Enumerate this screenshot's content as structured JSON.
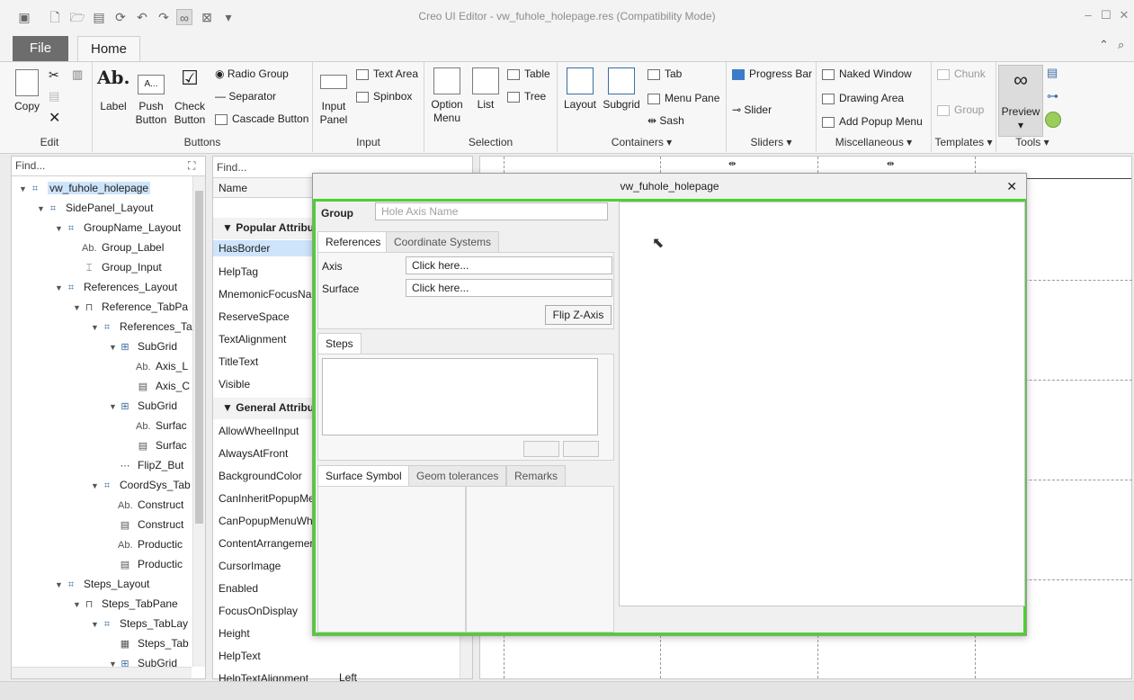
{
  "window": {
    "title": "Creo UI Editor - vw_fuhole_holepage.res (Compatibility Mode)"
  },
  "ribbon": {
    "tabs": {
      "file": "File",
      "home": "Home"
    },
    "edit": {
      "label": "Edit",
      "copy": "Copy"
    },
    "buttons": {
      "label": "Buttons",
      "label_btn": "Label",
      "push_button": "Push\nButton",
      "check_button": "Check\nButton",
      "radio_group": "Radio Group",
      "separator": "Separator",
      "cascade_button": "Cascade Button"
    },
    "input": {
      "label": "Input",
      "input_panel": "Input\nPanel",
      "text_area": "Text Area",
      "spinbox": "Spinbox"
    },
    "selection": {
      "label": "Selection",
      "option_menu": "Option\nMenu",
      "list": "List",
      "table": "Table",
      "tree": "Tree"
    },
    "containers": {
      "label": "Containers",
      "layout": "Layout",
      "subgrid": "Subgrid",
      "tab": "Tab",
      "menu_pane": "Menu Pane",
      "sash": "Sash"
    },
    "sliders": {
      "label": "Sliders",
      "progress_bar": "Progress Bar",
      "slider": "Slider"
    },
    "misc": {
      "label": "Miscellaneous",
      "naked_window": "Naked Window",
      "drawing_area": "Drawing Area",
      "add_popup_menu": "Add Popup Menu"
    },
    "templates": {
      "label": "Templates",
      "chunk": "Chunk",
      "group": "Group"
    },
    "tools": {
      "label": "Tools",
      "preview": "Preview"
    }
  },
  "tree": {
    "find_placeholder": "Find...",
    "nodes": [
      {
        "label": "vw_fuhole_holepage"
      },
      {
        "label": "SidePanel_Layout"
      },
      {
        "label": "GroupName_Layout"
      },
      {
        "label": "Group_Label"
      },
      {
        "label": "Group_Input"
      },
      {
        "label": "References_Layout"
      },
      {
        "label": "Reference_TabPa"
      },
      {
        "label": "References_Ta"
      },
      {
        "label": "SubGrid"
      },
      {
        "label": "Axis_L"
      },
      {
        "label": "Axis_C"
      },
      {
        "label": "SubGrid"
      },
      {
        "label": "Surfac"
      },
      {
        "label": "Surfac"
      },
      {
        "label": "FlipZ_But"
      },
      {
        "label": "CoordSys_Tab"
      },
      {
        "label": "Construct"
      },
      {
        "label": "Construct"
      },
      {
        "label": "Productic"
      },
      {
        "label": "Productic"
      },
      {
        "label": "Steps_Layout"
      },
      {
        "label": "Steps_TabPane"
      },
      {
        "label": "Steps_TabLay"
      },
      {
        "label": "Steps_Tab"
      },
      {
        "label": "SubGrid"
      }
    ]
  },
  "props": {
    "find_placeholder": "Find...",
    "name_header": "Name",
    "popular_header": "Popular Attribu",
    "popular": [
      "HasBorder",
      "HelpTag",
      "MnemonicFocusNa",
      "ReserveSpace",
      "TextAlignment",
      "TitleText",
      "Visible"
    ],
    "general_header": "General Attribu",
    "general": [
      "AllowWheelInput",
      "AlwaysAtFront",
      "BackgroundColor",
      "CanInheritPopupMe",
      "CanPopupMenuWh",
      "ContentArrangemer",
      "CursorImage",
      "Enabled",
      "FocusOnDisplay",
      "Height",
      "HelpText",
      "HelpTextAlignment"
    ],
    "last_value": "Left"
  },
  "dialog": {
    "title": "vw_fuhole_holepage",
    "group_label": "Group",
    "group_placeholder": "Hole Axis Name",
    "tab_references": "References",
    "tab_coord": "Coordinate Systems",
    "axis_label": "Axis",
    "axis_value": "Click here...",
    "surface_label": "Surface",
    "surface_value": "Click here...",
    "flip_button": "Flip Z-Axis",
    "steps_tab": "Steps",
    "tab_surface_symbol": "Surface Symbol",
    "tab_geom": "Geom tolerances",
    "tab_remarks": "Remarks"
  }
}
